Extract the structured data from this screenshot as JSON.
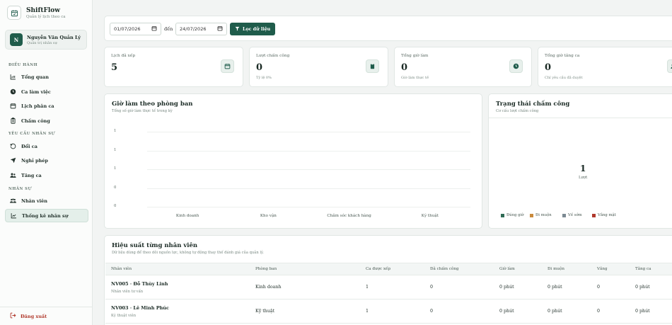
{
  "brand": {
    "name": "ShiftFlow",
    "subtitle": "Quản lý lịch theo ca"
  },
  "user": {
    "initial": "N",
    "name": "Nguyễn Văn Quản Lý",
    "role": "Quản trị nhân sự"
  },
  "sidebar": {
    "sections": [
      {
        "title": "ĐIỀU HÀNH",
        "items": [
          {
            "label": "Tổng quan",
            "icon": "bar-chart-icon"
          },
          {
            "label": "Ca làm việc",
            "icon": "clock-icon"
          },
          {
            "label": "Lịch phân ca",
            "icon": "calendar-icon"
          },
          {
            "label": "Chấm công",
            "icon": "clipboard-icon"
          }
        ]
      },
      {
        "title": "YÊU CẦU NHÂN SỰ",
        "items": [
          {
            "label": "Đổi ca",
            "icon": "refresh-icon"
          },
          {
            "label": "Nghỉ phép",
            "icon": "send-icon"
          },
          {
            "label": "Tăng ca",
            "icon": "users-icon"
          }
        ]
      },
      {
        "title": "NHÂN SỰ",
        "items": [
          {
            "label": "Nhân viên",
            "icon": "team-icon"
          },
          {
            "label": "Thống kê nhân sự",
            "icon": "trend-icon",
            "active": true
          }
        ]
      }
    ],
    "logout_label": "Đăng xuất"
  },
  "filter": {
    "from_date": "01/07/2026",
    "separator": "đến",
    "to_date": "24/07/2026",
    "button_label": "Lọc dữ liệu"
  },
  "stats": [
    {
      "label": "Lịch đã xếp",
      "value": "5",
      "sub": "",
      "icon": "calendar-icon"
    },
    {
      "label": "Lượt chấm công",
      "value": "0",
      "sub": "Tỷ lệ 0%",
      "icon": "clipboard-icon"
    },
    {
      "label": "Tổng giờ làm",
      "value": "0",
      "sub": "Giờ làm thực tế",
      "icon": "clock-icon"
    },
    {
      "label": "Tổng giờ tăng ca",
      "value": "0",
      "sub": "Chỉ yêu cầu đã duyệt",
      "icon": "users-icon"
    }
  ],
  "dept_chart": {
    "title": "Giờ làm theo phòng ban",
    "subtitle": "Tổng số giờ làm thực tế trong kỳ"
  },
  "chart_data": [
    {
      "type": "bar",
      "title": "Giờ làm theo phòng ban",
      "categories": [
        "Kinh doanh",
        "Kho vận",
        "Chăm sóc khách hàng",
        "Kỹ thuật"
      ],
      "values": [
        0,
        0,
        0,
        0
      ],
      "y_ticks": [
        "1",
        "1",
        "1",
        "0",
        "0"
      ],
      "grid": true
    },
    {
      "type": "pie",
      "title": "Trạng thái chấm công",
      "categories": [
        "Đúng giờ",
        "Đi muộn",
        "Về sớm",
        "Vắng mặt"
      ],
      "values": [
        0,
        0,
        0,
        0
      ],
      "center_value": "1",
      "center_unit": "Lượt",
      "colors": [
        "#2f6b55",
        "#c98a3d",
        "#7c8a93",
        "#b0392c"
      ]
    }
  ],
  "status_chart": {
    "title": "Trạng thái chấm công",
    "subtitle": "Cơ cấu lượt chấm công"
  },
  "perf_table": {
    "title": "Hiệu suất từng nhân viên",
    "subtitle": "Dữ liệu dùng để theo dõi nguồn lực, không tự động thay thế đánh giá của quản lý.",
    "headers": [
      "Nhân viên",
      "Phòng ban",
      "Ca được xếp",
      "Đã chấm công",
      "Giờ làm",
      "Đi muộn",
      "Vắng",
      "Tăng ca"
    ],
    "rows": [
      {
        "name": "NV005 · Đỗ Thùy Linh",
        "role": "Nhân viên tư vấn",
        "dept": "Kinh doanh",
        "shifts": "1",
        "checked": "0",
        "hours": "0 phút",
        "late": "0 phút",
        "absent": "0",
        "ot": "0 phút"
      },
      {
        "name": "NV003 · Lê Minh Phúc",
        "role": "Kỹ thuật viên",
        "dept": "Kỹ thuật",
        "shifts": "1",
        "checked": "0",
        "hours": "0 phút",
        "late": "0 phút",
        "absent": "0",
        "ot": "0 phút"
      }
    ]
  },
  "colors": {
    "primary": "#1f5c4b",
    "danger": "#b0392c"
  }
}
